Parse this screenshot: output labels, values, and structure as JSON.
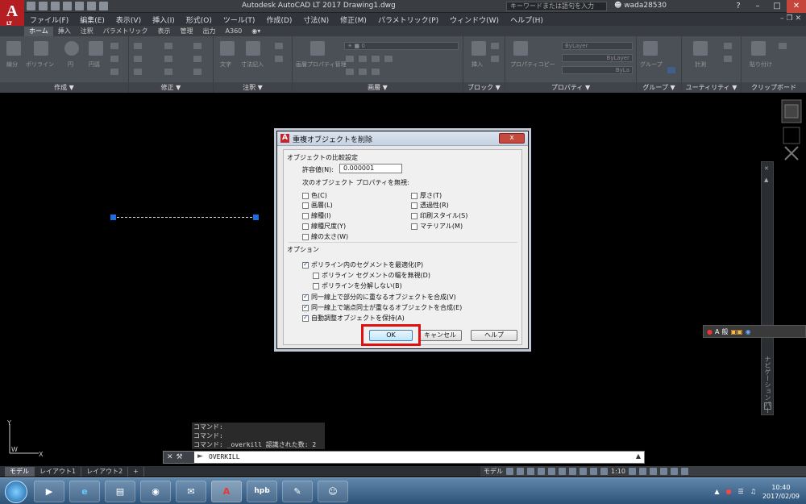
{
  "window": {
    "title": "Autodesk AutoCAD LT 2017    Drawing1.dwg",
    "search_placeholder": "キーワードまたは語句を入力",
    "user": "wada28530",
    "help_glyph": "?"
  },
  "menubar": {
    "items": [
      "ファイル(F)",
      "編集(E)",
      "表示(V)",
      "挿入(I)",
      "形式(O)",
      "ツール(T)",
      "作成(D)",
      "寸法(N)",
      "修正(M)",
      "パラメトリック(P)",
      "ウィンドウ(W)",
      "ヘルプ(H)"
    ]
  },
  "ribbon": {
    "tabs": [
      "ホーム",
      "挿入",
      "注釈",
      "パラメトリック",
      "表示",
      "管理",
      "出力",
      "A360"
    ],
    "panels": [
      "作成 ▼",
      "修正 ▼",
      "注釈 ▼",
      "画層 ▼",
      "ブロック ▼",
      "プロパティ ▼",
      "グループ ▼",
      "ユーティリティ ▼",
      "クリップボード"
    ],
    "tool_labels": {
      "line": "線分",
      "polyline": "ポリライン",
      "circle": "円",
      "arc": "円弧",
      "text": "文字",
      "dimension": "寸法記入",
      "layer_props": "画層プロパティ管理",
      "insert": "挿入",
      "props_copy": "プロパティコピー",
      "group": "グループ",
      "measure": "計測",
      "paste": "貼り付け"
    },
    "bylayer": [
      "ByLayer",
      "ByLayer",
      "ByLa"
    ]
  },
  "dialog": {
    "title": "重複オブジェクトを削除",
    "close_label": "x",
    "compare_section": "オブジェクトの比較設定",
    "tolerance_label": "許容値(N):",
    "tolerance_value": "0.000001",
    "ignore_label": "次のオブジェクト プロパティを無視:",
    "props_left": [
      {
        "label": "色(C)",
        "checked": false
      },
      {
        "label": "画層(L)",
        "checked": false
      },
      {
        "label": "線種(I)",
        "checked": false
      },
      {
        "label": "線種尺度(Y)",
        "checked": false
      },
      {
        "label": "線の太さ(W)",
        "checked": false
      }
    ],
    "props_right": [
      {
        "label": "厚さ(T)",
        "checked": false
      },
      {
        "label": "透過性(R)",
        "checked": false
      },
      {
        "label": "印刷スタイル(S)",
        "checked": false
      },
      {
        "label": "マテリアル(M)",
        "checked": false
      }
    ],
    "options_section": "オプション",
    "options": [
      {
        "label": "ポリライン内のセグメントを最適化(P)",
        "checked": true,
        "indent": false
      },
      {
        "label": "ポリライン セグメントの幅を無視(D)",
        "checked": false,
        "indent": true
      },
      {
        "label": "ポリラインを分解しない(B)",
        "checked": false,
        "indent": true
      },
      {
        "label": "同一線上で部分的に重なるオブジェクトを合成(V)",
        "checked": true,
        "indent": false
      },
      {
        "label": "同一線上で端点同士が重なるオブジェクトを合成(E)",
        "checked": true,
        "indent": false
      },
      {
        "label": "自動調整オブジェクトを保持(A)",
        "checked": true,
        "indent": false
      }
    ],
    "ok_label": "OK",
    "cancel_label": "キャンセル",
    "help_label": "ヘルプ"
  },
  "command": {
    "history": [
      "コマンド:",
      "コマンド:",
      "コマンド: _overkill 認識された数: 2"
    ],
    "current": "OVERKILL"
  },
  "navbar": {
    "label": "ナビゲーションバー"
  },
  "tray_widget": {
    "items": [
      "A",
      "般"
    ]
  },
  "layout_tabs": [
    "モデル",
    "レイアウト1",
    "レイアウト2",
    "+"
  ],
  "status_bar": {
    "model": "モデル",
    "scale": "1:10"
  },
  "ucs": {
    "x": "X",
    "y": "Y",
    "w": "W"
  },
  "taskbar": {
    "apps": [
      "e",
      "A",
      "hpb"
    ],
    "time": "10:40",
    "date": "2017/02/09"
  }
}
